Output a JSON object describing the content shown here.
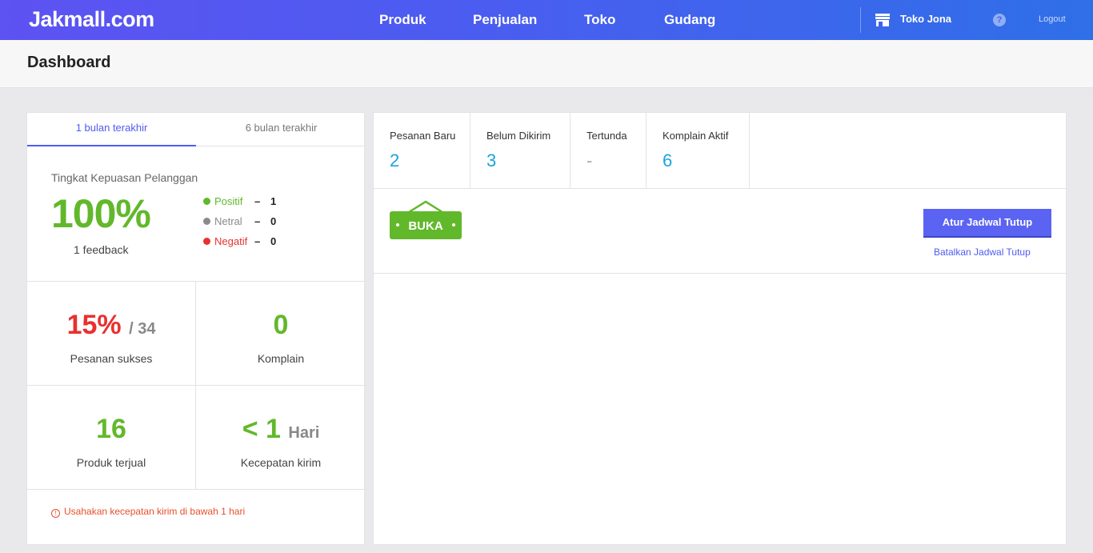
{
  "navbar": {
    "logo": "Jakmall.com",
    "menu": [
      "Produk",
      "Penjualan",
      "Toko",
      "Gudang"
    ],
    "store_name": "Toko Jona",
    "help_glyph": "?",
    "logout": "Logout"
  },
  "header": {
    "title": "Dashboard"
  },
  "left_panel": {
    "tabs": [
      "1 bulan terakhir",
      "6 bulan terakhir"
    ],
    "active_tab": "1 bulan terakhir",
    "satisfaction": {
      "title": "Tingkat Kepuasan Pelanggan",
      "percent": "100%",
      "feedback": "1 feedback",
      "breakdown": [
        {
          "label": "Positif",
          "dash": "–",
          "count": "1",
          "color": "#62b82b"
        },
        {
          "label": "Netral",
          "dash": "–",
          "count": "0",
          "color": "#8a8a8a"
        },
        {
          "label": "Negatif",
          "dash": "–",
          "count": "0",
          "color": "#e8312f"
        }
      ]
    },
    "stats": {
      "success": {
        "value": "15%",
        "total": "/ 34",
        "label": "Pesanan sukses"
      },
      "complaints": {
        "value": "0",
        "label": "Komplain"
      },
      "sold": {
        "value": "16",
        "label": "Produk terjual"
      },
      "speed": {
        "value": "< 1",
        "unit": "Hari",
        "label": "Kecepatan kirim"
      }
    },
    "warning": {
      "icon_glyph": "!",
      "text": "Usahakan kecepatan kirim di bawah 1 hari"
    }
  },
  "right_panel": {
    "order_stats": [
      {
        "label": "Pesanan Baru",
        "value": "2"
      },
      {
        "label": "Belum Dikirim",
        "value": "3"
      },
      {
        "label": "Tertunda",
        "value": "-"
      },
      {
        "label": "Komplain Aktif",
        "value": "6"
      }
    ],
    "status_sign": "BUKA",
    "schedule_button": "Atur Jadwal Tutup",
    "cancel_link": "Batalkan Jadwal Tutup"
  },
  "colors": {
    "accent": "#4f5bf0",
    "positive": "#62b82b",
    "negative": "#e8312f",
    "value_blue": "#1aa3e0",
    "warning": "#e84f2a"
  }
}
